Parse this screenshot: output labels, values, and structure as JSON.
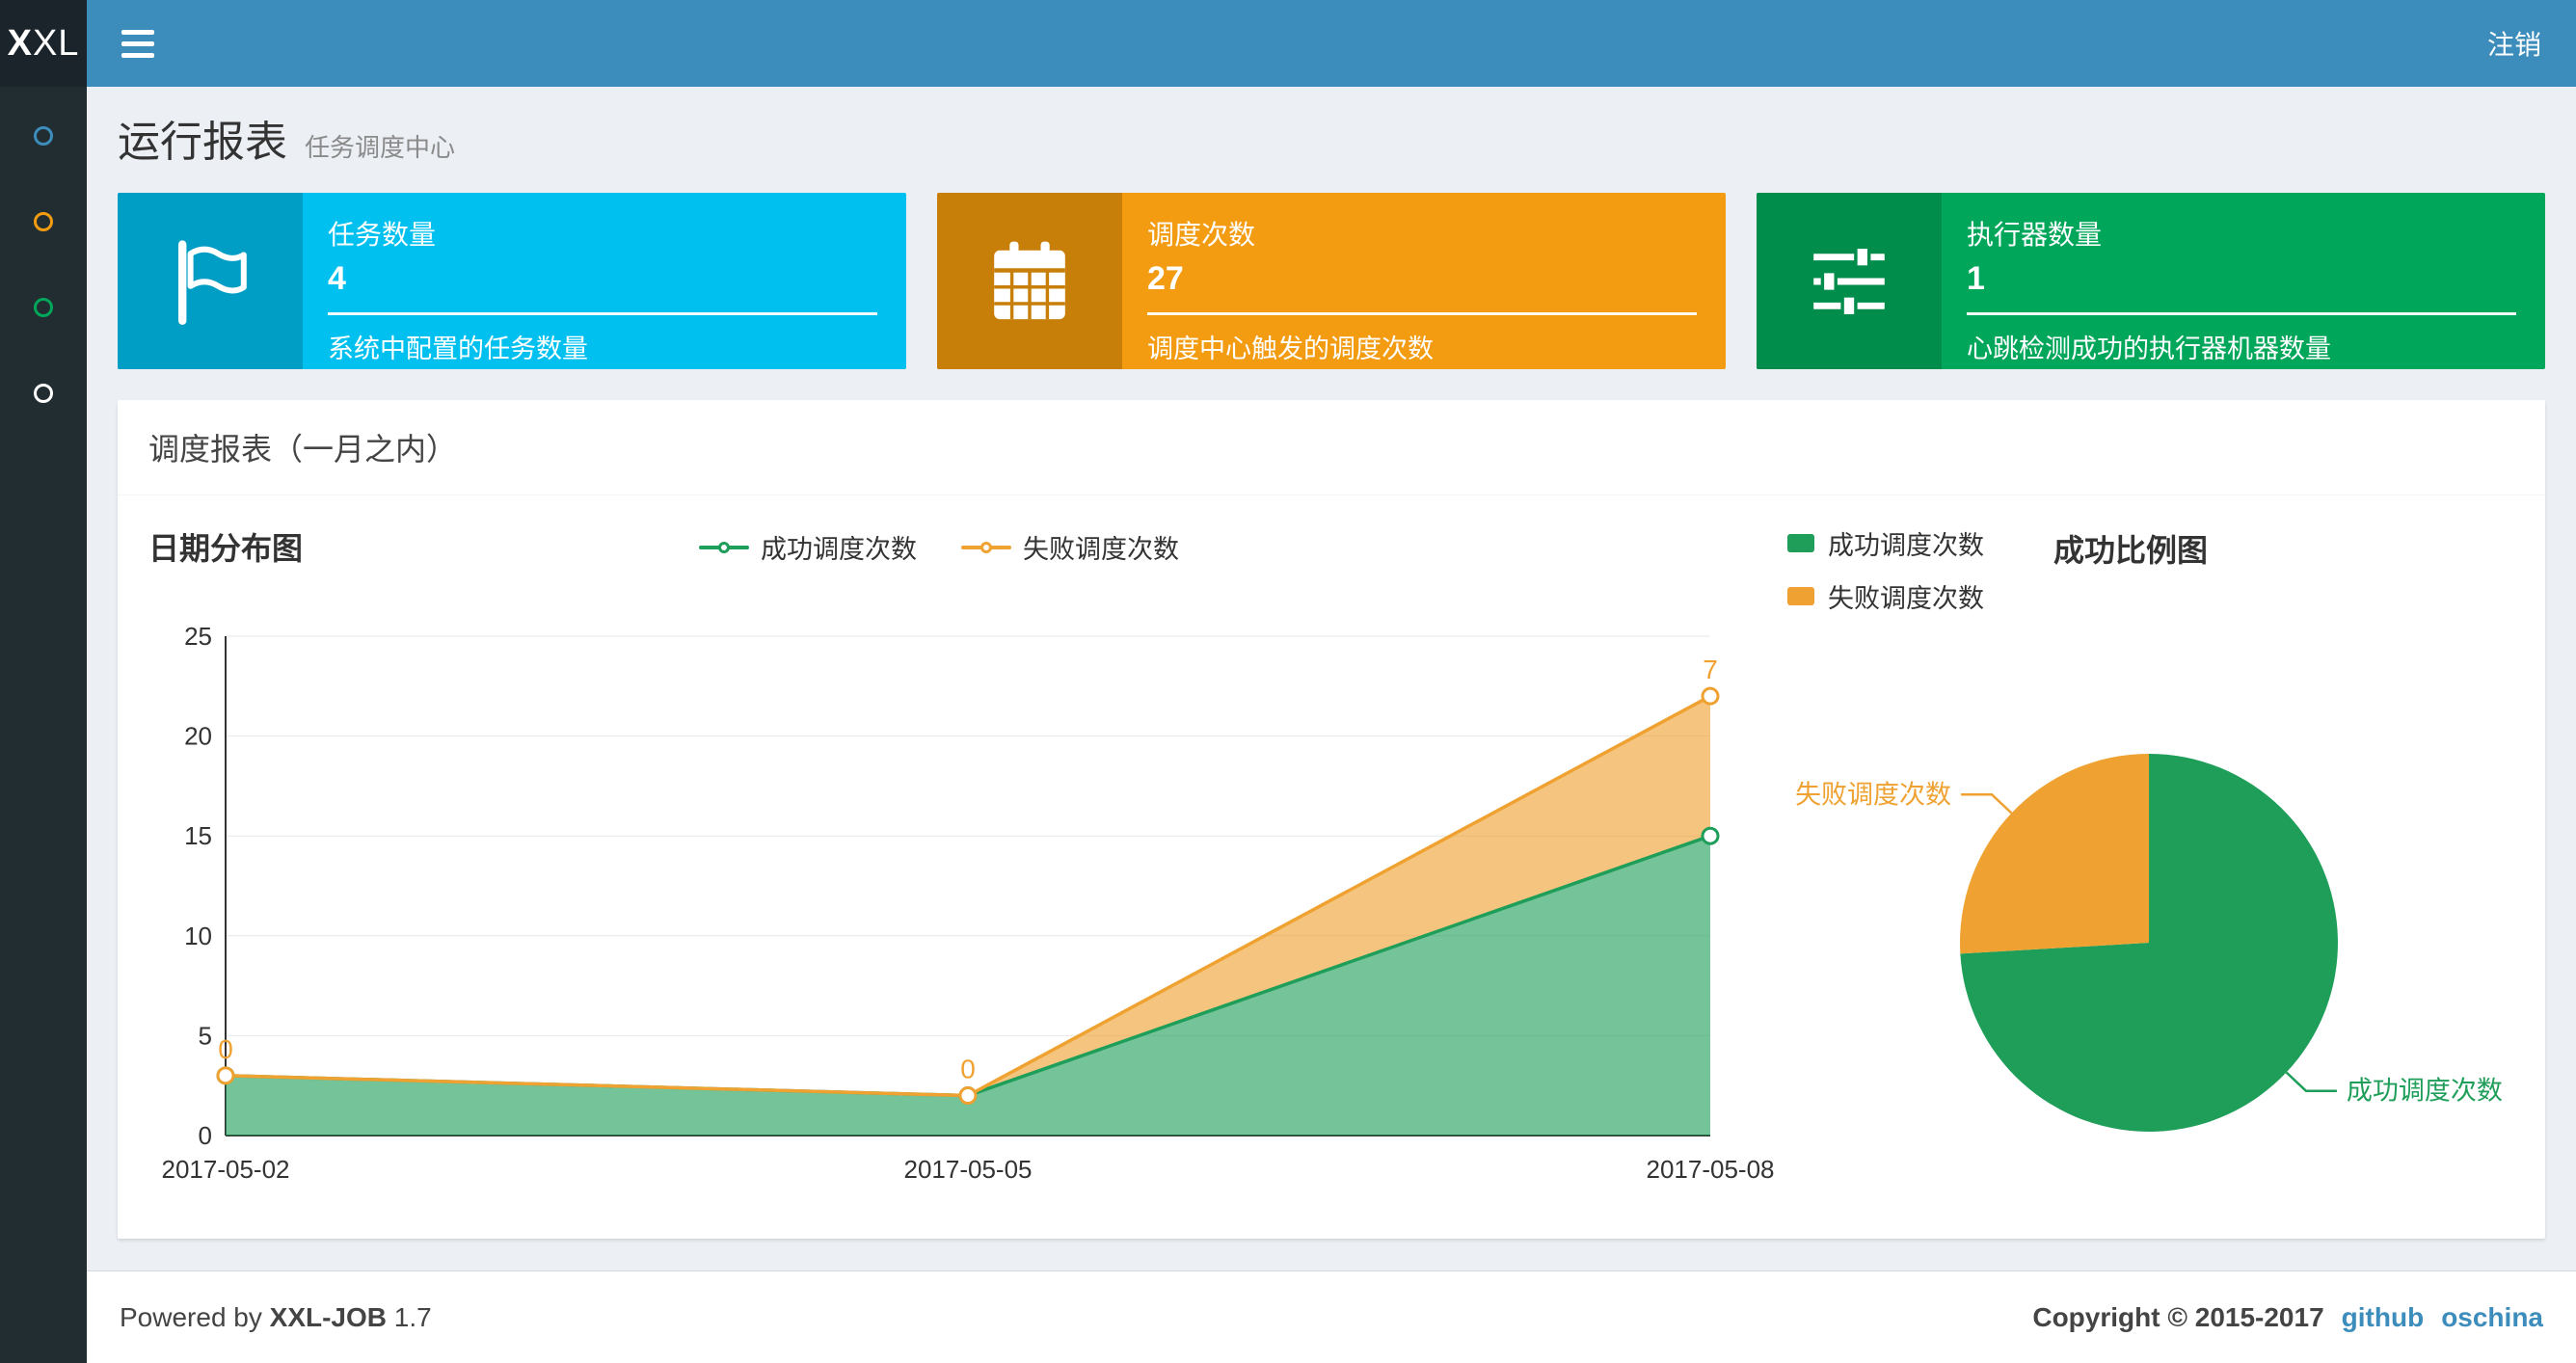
{
  "header": {
    "logo_bold": "X",
    "logo_rest": "XL",
    "logout_label": "注销"
  },
  "sidebar": {
    "items": [
      {
        "name": "menu-report",
        "color": "#3c8dbc"
      },
      {
        "name": "menu-job",
        "color": "#f39c12"
      },
      {
        "name": "menu-executor",
        "color": "#00a65a"
      },
      {
        "name": "menu-help",
        "color": "#ffffff"
      }
    ]
  },
  "page": {
    "title": "运行报表",
    "subtitle": "任务调度中心"
  },
  "info_boxes": [
    {
      "label": "任务数量",
      "value": "4",
      "desc": "系统中配置的任务数量",
      "bg": "#00c0ef",
      "icon_bg": "#009dc5",
      "icon": "flag-icon"
    },
    {
      "label": "调度次数",
      "value": "27",
      "desc": "调度中心触发的调度次数",
      "bg": "#f39c12",
      "icon_bg": "#c87f0a",
      "icon": "calendar-icon"
    },
    {
      "label": "执行器数量",
      "value": "1",
      "desc": "心跳检测成功的执行器机器数量",
      "bg": "#00a65a",
      "icon_bg": "#008d4c",
      "icon": "sliders-icon"
    }
  ],
  "panel": {
    "title": "调度报表（一月之内）"
  },
  "chart_data": [
    {
      "type": "area",
      "title": "日期分布图",
      "x": [
        "2017-05-02",
        "2017-05-05",
        "2017-05-08"
      ],
      "series": [
        {
          "name": "成功调度次数",
          "values": [
            3,
            2,
            15
          ],
          "color": "#1f9e5a"
        },
        {
          "name": "失败调度次数",
          "values": [
            0,
            0,
            7
          ],
          "color": "#efa231"
        }
      ],
      "stacked": true,
      "ylim": [
        0,
        25
      ],
      "yticks": [
        0,
        5,
        10,
        15,
        20,
        25
      ],
      "point_labels": [
        "0",
        "0",
        "7"
      ],
      "grid": true,
      "legend_position": "top-center"
    },
    {
      "type": "pie",
      "title": "成功比例图",
      "slices": [
        {
          "name": "成功调度次数",
          "value": 20,
          "color": "#1f9e5a"
        },
        {
          "name": "失败调度次数",
          "value": 7,
          "color": "#efa231"
        }
      ],
      "legend_position": "top-left"
    }
  ],
  "footer": {
    "powered_prefix": "Powered by",
    "brand": "XXL-JOB",
    "version": "1.7",
    "copyright": "Copyright © 2015-2017",
    "links": [
      {
        "label": "github"
      },
      {
        "label": "oschina"
      }
    ]
  }
}
